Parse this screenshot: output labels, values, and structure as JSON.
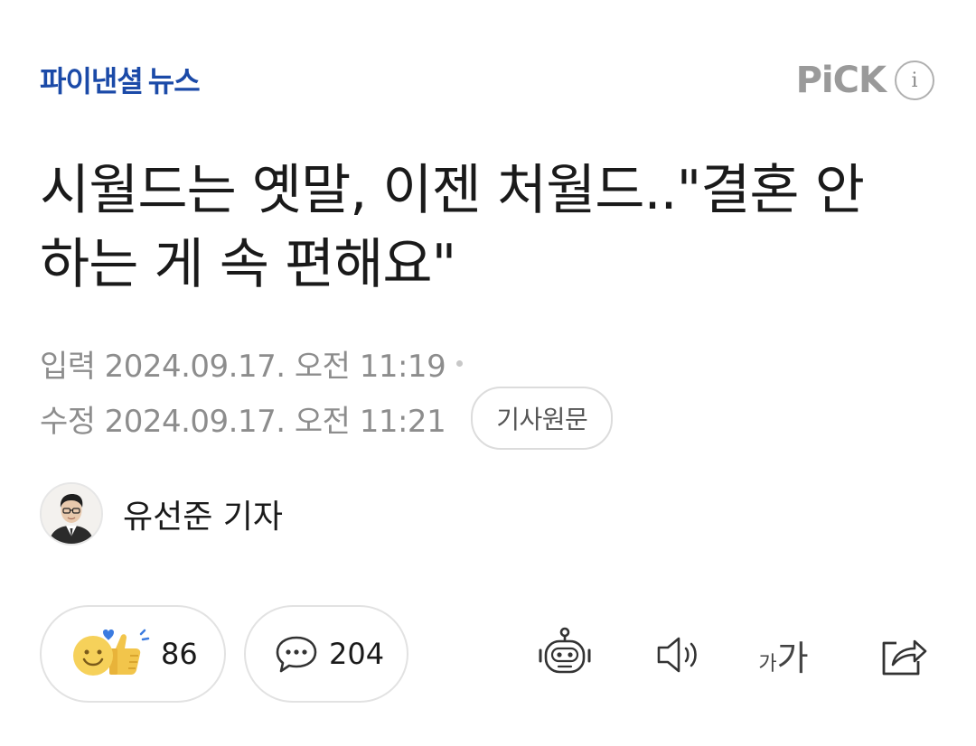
{
  "header": {
    "press_name_main": "파이낸셜",
    "press_name_sub": "뉴스",
    "pick_label": "PiCK",
    "info_glyph": "i"
  },
  "article": {
    "headline": "시월드는 옛말, 이젠 처월드..\"결혼 안 하는 게 속 편해요\"",
    "input_label": "입력",
    "input_datetime": "2024.09.17. 오전 11:19",
    "modified_label": "수정",
    "modified_datetime": "2024.09.17. 오전 11:21",
    "source_button": "기사원문",
    "author": "유선준 기자"
  },
  "actions": {
    "reaction_count": "86",
    "comment_count": "204",
    "font_small": "가",
    "font_big": "가"
  },
  "colors": {
    "brand_blue": "#1b4aa8",
    "meta_gray": "#8d8d8d",
    "border_gray": "#e2e2e2"
  },
  "icons": [
    "info-icon",
    "smile-emoji-icon",
    "thumbs-up-icon",
    "comment-icon",
    "robot-icon",
    "speaker-icon",
    "font-size-icon",
    "share-icon"
  ]
}
